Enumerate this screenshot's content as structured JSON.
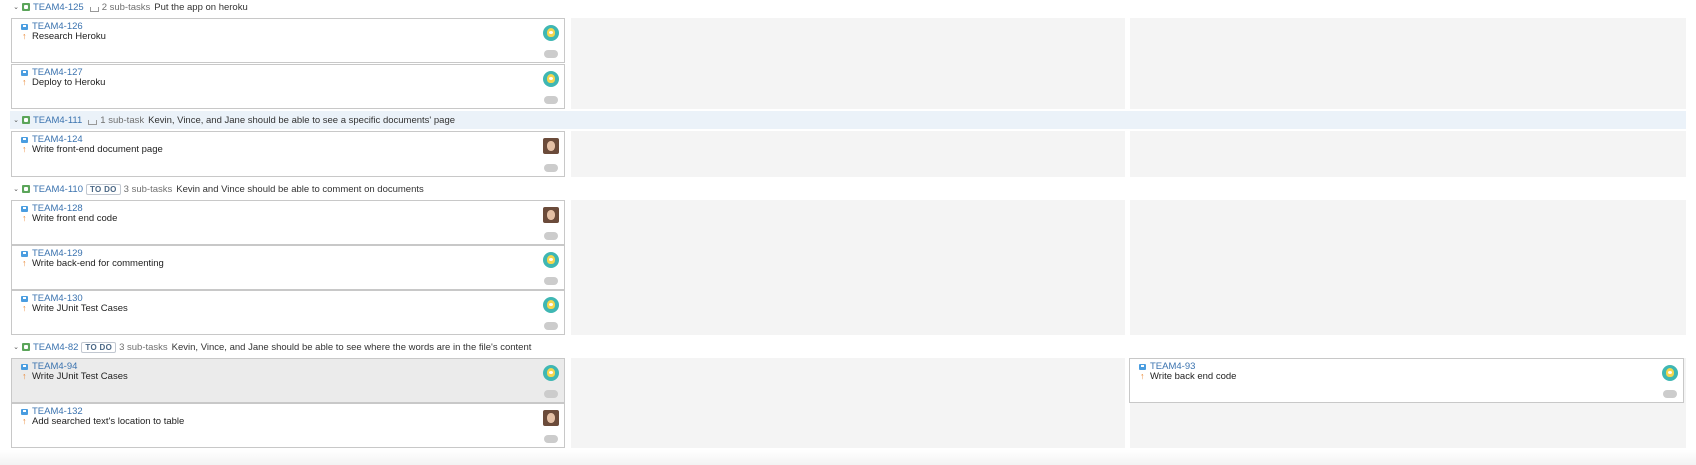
{
  "swimlanes": [
    {
      "key": "TEAM4-125",
      "badge": "",
      "subtask_count": "2 sub-tasks",
      "summary": "Put the app on heroku",
      "cards": [
        {
          "key": "TEAM4-126",
          "title": "Research Heroku",
          "avatar": "dog-avatar"
        },
        {
          "key": "TEAM4-127",
          "title": "Deploy to Heroku",
          "avatar": "dog-avatar"
        }
      ]
    },
    {
      "key": "TEAM4-111",
      "badge": "",
      "subtask_count": "1 sub-task",
      "summary": "Kevin, Vince, and Jane should be able to see a specific documents' page",
      "cards": [
        {
          "key": "TEAM4-124",
          "title": "Write front-end document page",
          "avatar": "user-photo"
        }
      ]
    },
    {
      "key": "TEAM4-110",
      "badge": "TO DO",
      "subtask_count": "3 sub-tasks",
      "summary": "Kevin and Vince should be able to comment on documents",
      "cards": [
        {
          "key": "TEAM4-128",
          "title": "Write front end code",
          "avatar": "user-photo"
        },
        {
          "key": "TEAM4-129",
          "title": "Write back-end for commenting",
          "avatar": "dog-avatar"
        },
        {
          "key": "TEAM4-130",
          "title": "Write JUnit Test Cases",
          "avatar": "dog-avatar"
        }
      ]
    },
    {
      "key": "TEAM4-82",
      "badge": "TO DO",
      "subtask_count": "3 sub-tasks",
      "summary": "Kevin, Vince, and Jane should be able to see where the words are in the file's content",
      "cards": [
        {
          "key": "TEAM4-94",
          "title": "Write JUnit Test Cases",
          "avatar": "dog-avatar",
          "selected": true
        },
        {
          "key": "TEAM4-132",
          "title": "Add searched text's location to table",
          "avatar": "user-photo"
        },
        {
          "key": "TEAM4-93",
          "title": "Write back end code",
          "avatar": "dog-avatar",
          "column": "done"
        }
      ]
    }
  ],
  "colors": {
    "link": "#3b73af",
    "priority": "#e9822b",
    "story_icon": "#5ba55a",
    "task_icon": "#4a9de0",
    "column_bg": "#f4f4f4",
    "highlight_row": "#ebf2f9"
  }
}
